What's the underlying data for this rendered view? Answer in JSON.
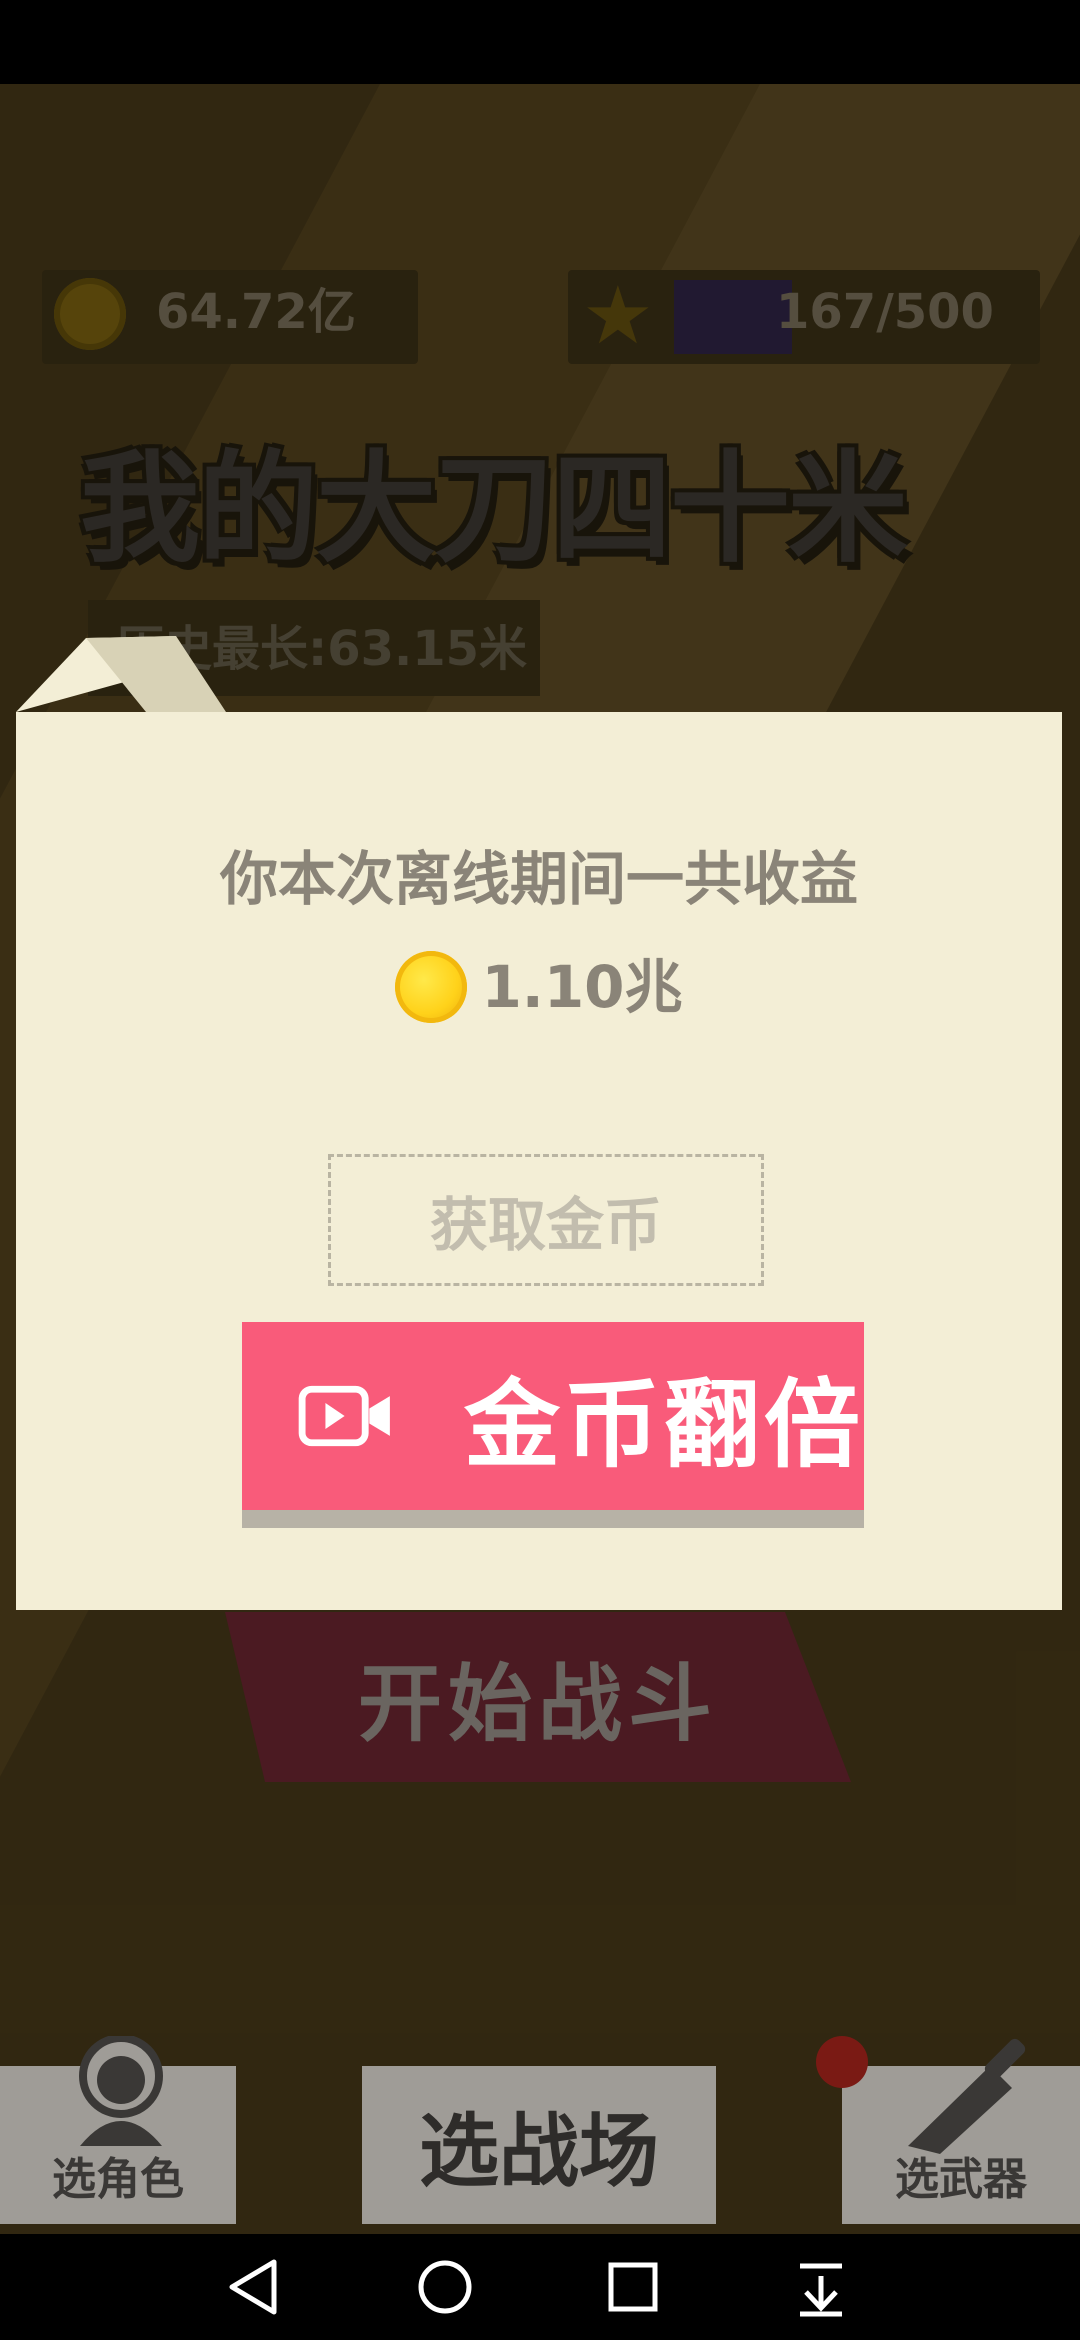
{
  "hud": {
    "coins": "64.72亿",
    "stars": "167/500",
    "star_progress": 0.334
  },
  "title": "我的大刀四十米",
  "history": {
    "label": "历史最长:63.15米"
  },
  "dialog": {
    "message": "你本次离线期间一共收益",
    "earnings": "1.10兆",
    "get_coins_label": "获取金币",
    "double_label": "金币翻倍"
  },
  "start_battle_label": "开始战斗",
  "tabs": {
    "character": "选角色",
    "arena": "选战场",
    "weapon": "选武器"
  },
  "colors": {
    "dialog_bg": "#f3eed6",
    "double_button": "#f95b7a",
    "coin_gold": "#ffd21a"
  },
  "icons": {
    "coin": "coin-icon",
    "star": "star-icon",
    "video": "video-camera-icon",
    "person": "person-icon",
    "knife": "knife-icon",
    "nav_back": "back-triangle-icon",
    "nav_home": "home-circle-icon",
    "nav_recents": "recents-square-icon",
    "nav_menu": "download-arrow-icon"
  }
}
